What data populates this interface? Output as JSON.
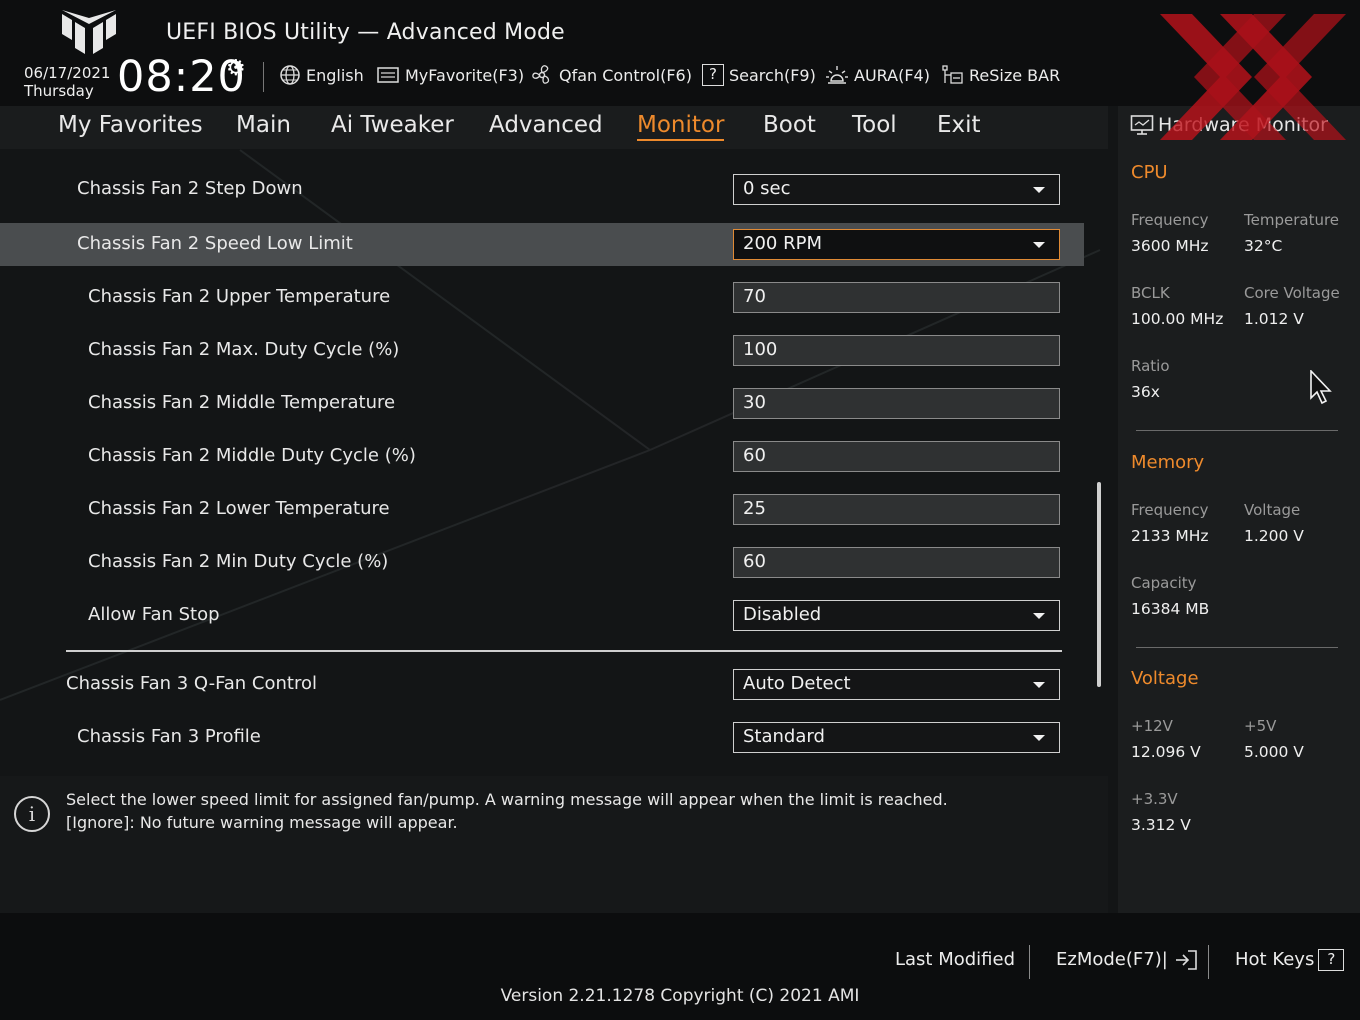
{
  "header": {
    "title": "UEFI BIOS Utility — Advanced Mode",
    "date": "06/17/2021",
    "day": "Thursday",
    "time": "08:20",
    "toolbar": [
      {
        "label": "English",
        "icon": "globe-icon"
      },
      {
        "label": "MyFavorite(F3)",
        "icon": "favorite-list-icon"
      },
      {
        "label": "Qfan Control(F6)",
        "icon": "fan-icon"
      },
      {
        "label": "Search(F9)",
        "icon": "search-help-icon"
      },
      {
        "label": "AURA(F4)",
        "icon": "aura-light-icon"
      },
      {
        "label": "ReSize BAR",
        "icon": "resize-bar-icon"
      }
    ]
  },
  "tabs": [
    {
      "label": "My Favorites"
    },
    {
      "label": "Main"
    },
    {
      "label": "Ai Tweaker"
    },
    {
      "label": "Advanced"
    },
    {
      "label": "Monitor",
      "active": true
    },
    {
      "label": "Boot"
    },
    {
      "label": "Tool"
    },
    {
      "label": "Exit"
    }
  ],
  "settings": [
    {
      "label": "Chassis Fan 2 Step Down",
      "value": "0 sec",
      "type": "dropdown"
    },
    {
      "label": "Chassis Fan 2 Speed Low Limit",
      "value": "200 RPM",
      "type": "dropdown",
      "selected": true
    },
    {
      "label": "Chassis Fan 2 Upper Temperature",
      "value": "70",
      "type": "input"
    },
    {
      "label": "Chassis Fan 2 Max. Duty Cycle (%)",
      "value": "100",
      "type": "input"
    },
    {
      "label": "Chassis Fan 2 Middle Temperature",
      "value": "30",
      "type": "input"
    },
    {
      "label": "Chassis Fan 2 Middle Duty Cycle (%)",
      "value": "60",
      "type": "input"
    },
    {
      "label": "Chassis Fan 2 Lower Temperature",
      "value": "25",
      "type": "input"
    },
    {
      "label": "Chassis Fan 2 Min Duty Cycle (%)",
      "value": "60",
      "type": "input"
    },
    {
      "label": "Allow Fan Stop",
      "value": "Disabled",
      "type": "dropdown"
    },
    {
      "label": "Chassis Fan 3 Q-Fan Control",
      "value": "Auto Detect",
      "type": "dropdown"
    },
    {
      "label": "Chassis Fan 3 Profile",
      "value": "Standard",
      "type": "dropdown"
    }
  ],
  "help": {
    "line1": "Select the lower speed limit for assigned fan/pump. A warning message will appear when the limit is reached.",
    "line2": "[Ignore]: No future warning message will appear."
  },
  "hardware_monitor": {
    "title": "Hardware Monitor",
    "cpu": {
      "heading": "CPU",
      "frequency_label": "Frequency",
      "frequency": "3600 MHz",
      "temperature_label": "Temperature",
      "temperature": "32°C",
      "bclk_label": "BCLK",
      "bclk": "100.00 MHz",
      "core_voltage_label": "Core Voltage",
      "core_voltage": "1.012 V",
      "ratio_label": "Ratio",
      "ratio": "36x"
    },
    "memory": {
      "heading": "Memory",
      "frequency_label": "Frequency",
      "frequency": "2133 MHz",
      "voltage_label": "Voltage",
      "voltage": "1.200 V",
      "capacity_label": "Capacity",
      "capacity": "16384 MB"
    },
    "voltage": {
      "heading": "Voltage",
      "v12_label": "+12V",
      "v12": "12.096 V",
      "v5_label": "+5V",
      "v5": "5.000 V",
      "v33_label": "+3.3V",
      "v33": "3.312 V"
    }
  },
  "footer": {
    "last_modified": "Last Modified",
    "ezmode": "EzMode(F7)|",
    "hot_keys": "Hot Keys",
    "hot_keys_glyph": "?",
    "version": "Version 2.21.1278 Copyright (C) 2021 AMI"
  },
  "colors": {
    "accent": "#ee8a2c",
    "watermark": "#c0121b",
    "selected_row": "#4a4d4f"
  }
}
